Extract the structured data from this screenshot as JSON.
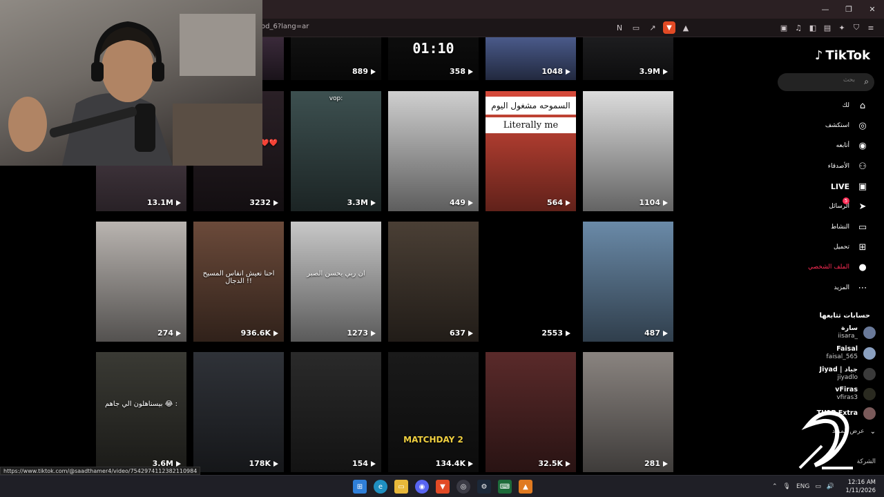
{
  "browser": {
    "url": "od_6?lang=ar",
    "status_url": "https://www.tiktok.com/@saadthamer4/video/7542974112382110984"
  },
  "tiktok": {
    "logo_text": "TikTok",
    "search_placeholder": "بحث",
    "nav": [
      {
        "label": "لك",
        "icon": "home-icon"
      },
      {
        "label": "استكشف",
        "icon": "explore-icon"
      },
      {
        "label": "أتابعه",
        "icon": "following-icon"
      },
      {
        "label": "الأصدقاء",
        "icon": "friends-icon"
      },
      {
        "label": "LIVE",
        "icon": "live-icon"
      },
      {
        "label": "الرسائل",
        "icon": "messages-icon",
        "badge": "5"
      },
      {
        "label": "النشاط",
        "icon": "activity-icon"
      },
      {
        "label": "تحميل",
        "icon": "upload-icon"
      },
      {
        "label": "الملف الشخصي",
        "icon": "profile-icon"
      },
      {
        "label": "المزيد",
        "icon": "more-icon"
      }
    ],
    "following_title": "حسابات تتابعها",
    "following": [
      {
        "name": "سارة",
        "handle": "iisara_"
      },
      {
        "name": "Faisal",
        "handle": "faisal_565"
      },
      {
        "name": "Jiyad | جياد",
        "handle": "jiyadlo"
      },
      {
        "name": "vFiras",
        "handle": "vfiras3"
      },
      {
        "name": "TU1P Extra",
        "handle": ""
      }
    ],
    "see_more": "عرض المزيد",
    "company": "الشركة"
  },
  "videos": [
    {
      "views": "",
      "overlay": "",
      "color": "#3a2a3a"
    },
    {
      "views": "889",
      "overlay": "",
      "color": "#111111"
    },
    {
      "views": "358",
      "overlay": "01:10",
      "color": "#0d0d0d"
    },
    {
      "views": "1048",
      "overlay": "",
      "color": "#4a5a8a"
    },
    {
      "views": "3.9M",
      "overlay": "",
      "color": "#1d1d1f"
    },
    {
      "views": "13.1M",
      "overlay": "",
      "color": "#5a4a55"
    },
    {
      "views": "3232",
      "overlay": "تجميعات من المقطع ❤️❤️",
      "color": "#2a2026"
    },
    {
      "views": "3.3M",
      "overlay": "vop:",
      "color": "#3d5050"
    },
    {
      "views": "449",
      "overlay": "",
      "color": "#cfcfcf"
    },
    {
      "views": "564",
      "overlay": "السموحه مشغول اليوم",
      "overlay2": "Literally me",
      "color": "#d64a3a"
    },
    {
      "views": "1104",
      "overlay": "",
      "color": "#dcdcdc"
    },
    {
      "views": "274",
      "overlay": "",
      "color": "#b9b4b0"
    },
    {
      "views": "936.6K",
      "overlay": "احنا نعيش انفاس المسيح الدجال !!",
      "color": "#6b4a3a"
    },
    {
      "views": "1273",
      "overlay": "ان ربي يحسن الصبر",
      "color": "#c8c8c8"
    },
    {
      "views": "637",
      "overlay": "",
      "color": "#4a3f35"
    },
    {
      "views": "2553",
      "overlay": "",
      "color": "#000000"
    },
    {
      "views": "487",
      "overlay": "",
      "color": "#6a8aa8"
    },
    {
      "views": "3.6M",
      "overlay": "بيسناهلون الي جاهم 😂 :",
      "color": "#3a3a34"
    },
    {
      "views": "178K",
      "overlay": "",
      "color": "#2f3238"
    },
    {
      "views": "154",
      "overlay": "",
      "color": "#2a2a2a"
    },
    {
      "views": "134.4K",
      "overlay": "MATCHDAY 2",
      "color": "#1a1a1a"
    },
    {
      "views": "32.5K",
      "overlay": "",
      "color": "#5a2a2a"
    },
    {
      "views": "281",
      "overlay": "",
      "color": "#8a8480"
    }
  ],
  "taskbar": {
    "lang": "ENG",
    "time": "12:16 AM",
    "date": "1/11/2026"
  }
}
